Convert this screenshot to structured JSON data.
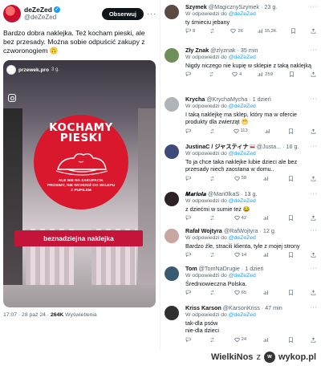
{
  "tweet": {
    "display_name": "deZeZed",
    "handle": "@deZeZed",
    "follow_label": "Obserwuj",
    "text": "Bardzo dobra naklejka. Też kocham pieski, ale bez przesady. Można sobie odpuścić zakupy z czworonogiem 🙃",
    "image": {
      "story_user": "przewek.pro",
      "story_time": "3 g.",
      "sign_title": "KOCHAMY PIESKI",
      "sign_text": "ALE NIE NA ZAKUPACH.\nPROSIMY, NIE WCHODŹ DO SKLEPU\nZ PUPILEM",
      "banner": "beznadziejna naklejka"
    },
    "time": "17:07 · 28 paź 24",
    "views_count": "264K",
    "views_label": "Wyświetlenia"
  },
  "replies": [
    {
      "name": "Szymek",
      "handle": "@MagicznySzymek · 23 g.",
      "reply_to": "deZeZed",
      "text": "ty śmieciu jebany",
      "replies": "8",
      "reposts": "",
      "likes": "26",
      "views": "15,2K",
      "avatar_color": "#5a4a42"
    },
    {
      "name": "Zły Znak",
      "handle": "@zlyznak · 35 min",
      "reply_to": "deZeZed",
      "text": "Nigdy niczego nie kupię w sklepie z taką naklejką",
      "replies": "",
      "reposts": "",
      "likes": "4",
      "views": "259",
      "avatar_color": "#6f8f5a"
    },
    {
      "name": "Krycha",
      "handle": "@KrychaMycha · 1 dzień",
      "reply_to": "deZeZed",
      "text": "I taką naklejkę ma sklep, który ma w ofercie produkty dla zwierząt 😁",
      "replies": "",
      "reposts": "",
      "likes": "113",
      "views": "",
      "avatar_color": "#b0b4b8"
    },
    {
      "name": "JustinaC / ジャスティナ",
      "handle": "@Justa... · 16 g.",
      "reply_to": "deZeZed",
      "text": "To ja chce taka naklejke lubie dzieci ale bez przesady niech zaostana w domu..",
      "replies": "",
      "reposts": "",
      "likes": "58",
      "views": "",
      "avatar_color": "#3e4a7a"
    },
    {
      "name": "𝑴𝒂𝒓𝒊𝒐𝒍𝒂",
      "handle": "@Mari0lkaS · 13 g.",
      "reply_to": "deZeZed",
      "text": "z dziećmi w sumie też 😂",
      "replies": "",
      "reposts": "",
      "likes": "42",
      "views": "",
      "avatar_color": "#2b2226"
    },
    {
      "name": "Rafał Wojtyra",
      "handle": "@RafWojtyra · 12 g.",
      "reply_to": "deZeZed",
      "text": "Bardzo źle, stracili klienta, tyle z mojej strony",
      "replies": "",
      "reposts": "",
      "likes": "14",
      "views": "",
      "avatar_color": "#c9a7a0"
    },
    {
      "name": "Tom",
      "handle": "@TomNaDrugie · 1 dzień",
      "reply_to": "deZeZed",
      "text": "Średniowieczna Polska.",
      "replies": "",
      "reposts": "",
      "likes": "65",
      "views": "",
      "avatar_color": "#3a5a70"
    },
    {
      "name": "Kriss Karson",
      "handle": "@KarsonKriss · 47 min",
      "reply_to": "deZeZed",
      "text": "tak-dla psów\nnie-dla dzieci",
      "replies": "",
      "reposts": "",
      "likes": "24",
      "views": "",
      "avatar_color": "#2f2f2f"
    }
  ],
  "reply_to_prefix": "W odpowiedzi do",
  "footer": {
    "brand_left": "WielkiNos",
    "brand_sep": "z",
    "brand_right": "wykop.pl"
  }
}
